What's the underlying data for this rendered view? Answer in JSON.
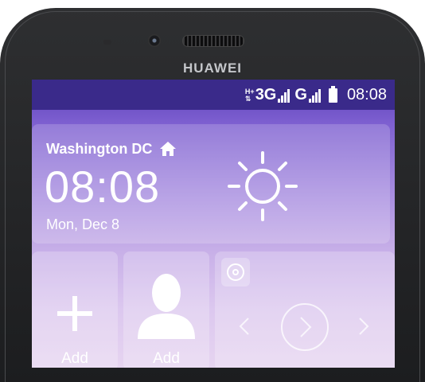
{
  "device": {
    "brand": "HUAWEI"
  },
  "status_bar": {
    "network1_prefix_top": "H+",
    "network1_prefix_bottom": "⇅",
    "network1_label": "3G",
    "network2_label": "G",
    "time": "08:08"
  },
  "weather_widget": {
    "city": "Washington DC",
    "time": "08:08",
    "date": "Mon, Dec 8",
    "icon": "sun-icon"
  },
  "tiles": [
    {
      "label": "Add",
      "icon": "plus-icon"
    },
    {
      "label": "Add",
      "icon": "contact-icon"
    }
  ],
  "music_widget": {
    "icons": [
      "music-icon",
      "previous-icon",
      "play-icon",
      "next-icon"
    ]
  },
  "colors": {
    "status_bar": "#3a2a8a",
    "wallpaper_top": "#5a3fb8",
    "wallpaper_bottom": "#e6d4f0"
  }
}
